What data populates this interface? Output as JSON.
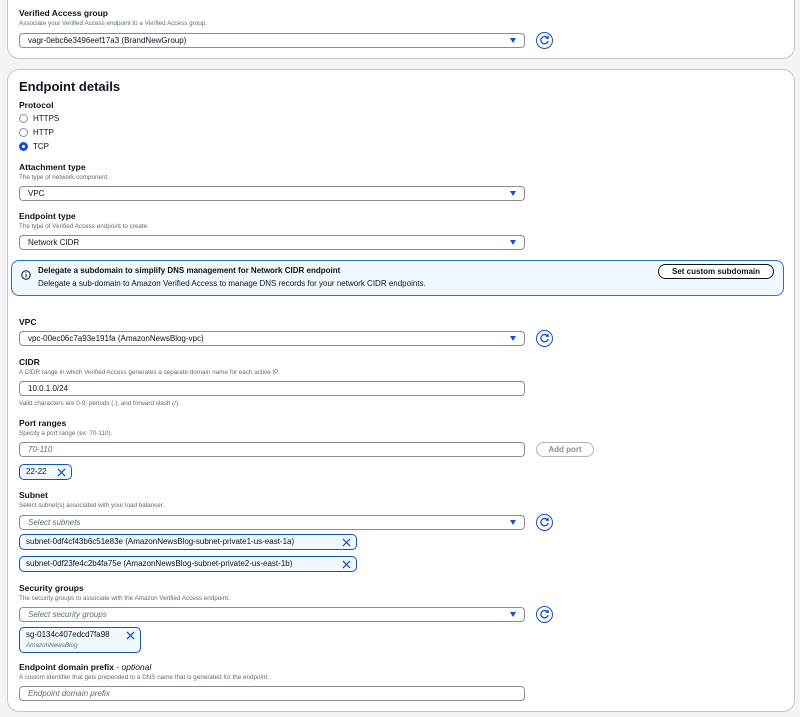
{
  "group_section": {
    "label": "Verified Access group",
    "description": "Associate your Verified Access endpoint to a Verified Access group.",
    "value": "vagr-0ebc6e3496eef17a3 (BrandNewGroup)"
  },
  "endpoint_details": {
    "title": "Endpoint details",
    "protocol": {
      "label": "Protocol",
      "options": [
        "HTTPS",
        "HTTP",
        "TCP"
      ],
      "selected": "TCP"
    },
    "attachment_type": {
      "label": "Attachment type",
      "description": "The type of network component.",
      "value": "VPC"
    },
    "endpoint_type": {
      "label": "Endpoint type",
      "description": "The type of Verified Access endpoint to create.",
      "value": "Network CIDR"
    },
    "info": {
      "title": "Delegate a subdomain to simplify DNS management for Network CIDR endpoint",
      "body": "Delegate a sub-domain to Amazon Verified Access to manage DNS records for your network CIDR endpoints.",
      "button": "Set custom subdomain"
    },
    "vpc": {
      "label": "VPC",
      "value": "vpc-00ec06c7a93e191fa (AmazonNewsBlog-vpc)"
    },
    "cidr": {
      "label": "CIDR",
      "description": "A CIDR range in which Verified Access generates a separate domain name for each active IP.",
      "value": "10.0.1.0/24",
      "hint": "Valid characters are 0-9, periods (.), and forward slash (/)."
    },
    "port_ranges": {
      "label": "Port ranges",
      "description": "Specify a port range (ex: 70-110).",
      "placeholder": "70-110",
      "add_button": "Add port",
      "tokens": [
        "22-22"
      ]
    },
    "subnet": {
      "label": "Subnet",
      "description": "Select subnet(s) associated with your load balancer.",
      "placeholder": "Select subnets",
      "tokens": [
        "subnet-0df4cf43b6c51e83e (AmazonNewsBlog-subnet-private1-us-east-1a)",
        "subnet-0df23fe4c2b4fa75e (AmazonNewsBlog-subnet-private2-us-east-1b)"
      ]
    },
    "security_groups": {
      "label": "Security groups",
      "description": "The security groups to associate with the  Amazon  Verified Access endpoint.",
      "placeholder": "Select security groups",
      "token": "sg-0134c407edcd7fa98",
      "token_sub": "AmazonNewsBlog"
    },
    "domain_prefix": {
      "label": "Endpoint domain prefix",
      "optional": "- optional",
      "description": "A custom identifier that gets prepended to a DNS name that is generated for the endpoint.",
      "placeholder": "Endpoint domain prefix"
    }
  },
  "colors": {
    "accent": "#0f4fd9",
    "info_border": "#1d6fe8",
    "info_bg": "#f1f8ff",
    "border": "#8c8c94",
    "muted_text": "#5f6b7a"
  },
  "icons": [
    "caret-down-icon",
    "refresh-icon",
    "info-icon",
    "close-icon"
  ]
}
